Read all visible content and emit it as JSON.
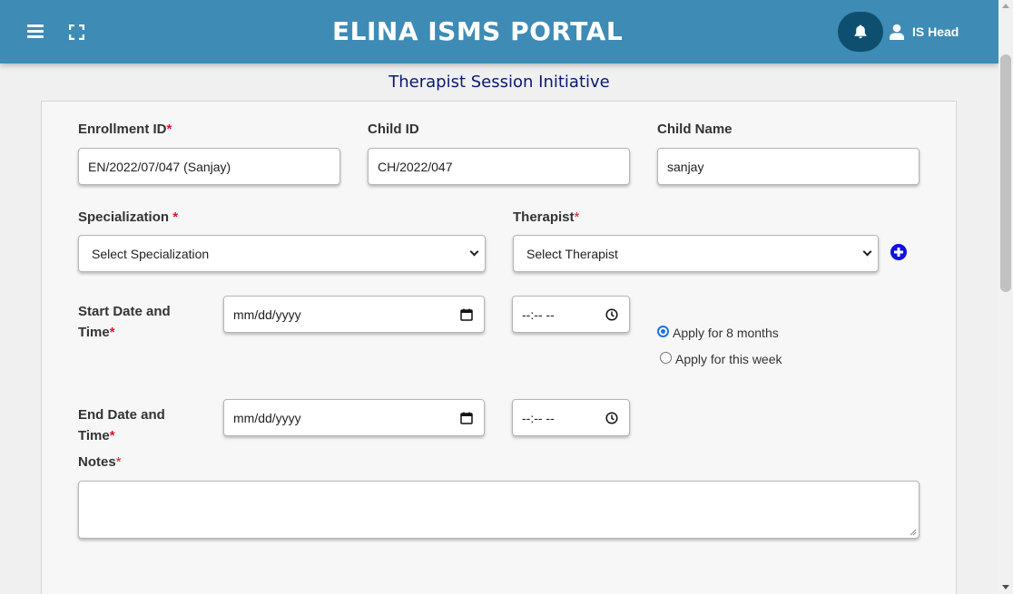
{
  "header": {
    "title": "ELINA ISMS PORTAL",
    "user_name": "IS Head"
  },
  "page": {
    "title": "Therapist Session Initiative"
  },
  "form": {
    "enrollment_id": {
      "label": "Enrollment ID",
      "value": "EN/2022/07/047 (Sanjay)"
    },
    "child_id": {
      "label": "Child ID",
      "value": "CH/2022/047"
    },
    "child_name": {
      "label": "Child Name",
      "value": "sanjay"
    },
    "specialization": {
      "label": "Specialization ",
      "selected": "Select Specialization"
    },
    "therapist": {
      "label": "Therapist",
      "selected": "Select Therapist"
    },
    "start": {
      "label_line1": "Start Date and",
      "label_line2": "Time",
      "date_placeholder": "mm/dd/yyyy",
      "time_placeholder": "--:-- --"
    },
    "end": {
      "label_line1": "End Date and",
      "label_line2": "Time",
      "date_placeholder": "mm/dd/yyyy",
      "time_placeholder": "--:-- --"
    },
    "apply_options": [
      {
        "label": "Apply for 8 months",
        "checked": true
      },
      {
        "label": "Apply for this week",
        "checked": false
      }
    ],
    "notes": {
      "label": "Notes",
      "value": ""
    },
    "required_mark": "*"
  },
  "colors": {
    "header_bg": "#3e8bb5",
    "bell_bg": "#0e4f70",
    "title_color": "#0a1a6e",
    "required": "#e0142b",
    "add_icon": "#1010e0"
  }
}
